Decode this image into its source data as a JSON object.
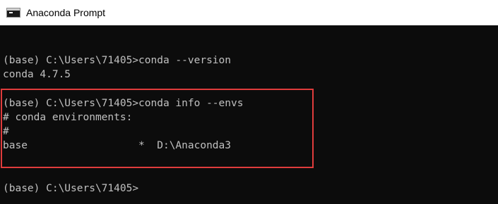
{
  "window": {
    "title": "Anaconda Prompt",
    "icon": "console-window-icon"
  },
  "console": {
    "lines": [
      "(base) C:\\Users\\71405>conda --version",
      "conda 4.7.5",
      "(base) C:\\Users\\71405>conda info --envs",
      "# conda environments:",
      "#",
      "base                  *  D:\\Anaconda3",
      "(base) C:\\Users\\71405>"
    ]
  },
  "colors": {
    "console_background": "#0c0c0c",
    "console_text": "#c0c0c0",
    "highlight_border": "#e03c3c",
    "titlebar_background": "#ffffff"
  }
}
